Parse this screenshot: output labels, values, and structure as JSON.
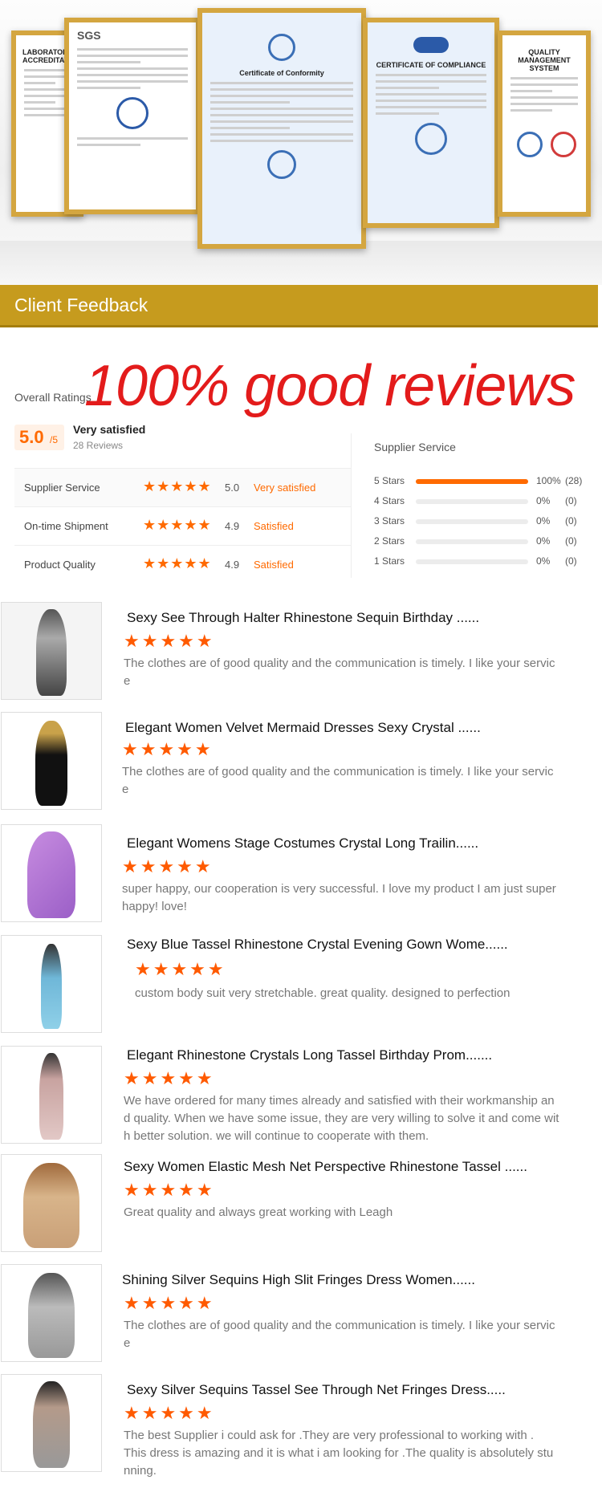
{
  "section_title": "Client Feedback",
  "headline": "100% good reviews",
  "overall": {
    "label": "Overall Ratings",
    "score": "5.0",
    "score_suffix": "/5",
    "summary": "Very satisfied",
    "review_count": "28 Reviews"
  },
  "metrics": [
    {
      "label": "Supplier Service",
      "stars": "★★★★★",
      "value": "5.0",
      "rating_text": "Very satisfied"
    },
    {
      "label": "On-time Shipment",
      "stars": "★★★★★",
      "value": "4.9",
      "rating_text": "Satisfied"
    },
    {
      "label": "Product Quality",
      "stars": "★★★★★",
      "value": "4.9",
      "rating_text": "Satisfied"
    }
  ],
  "distribution": {
    "title": "Supplier Service",
    "rows": [
      {
        "label": "5 Stars",
        "percent": "100%",
        "count": "(28)",
        "fraction": 1.0
      },
      {
        "label": "4 Stars",
        "percent": "0%",
        "count": "(0)",
        "fraction": 0
      },
      {
        "label": "3 Stars",
        "percent": "0%",
        "count": "(0)",
        "fraction": 0
      },
      {
        "label": "2 Stars",
        "percent": "0%",
        "count": "(0)",
        "fraction": 0
      },
      {
        "label": "1 Stars",
        "percent": "0%",
        "count": "(0)",
        "fraction": 0
      }
    ]
  },
  "reviews": [
    {
      "title": "Sexy See Through Halter Rhinestone Sequin Birthday ......",
      "stars": "★★★★★",
      "body": "The clothes are of good quality and the communication is timely. I like your servic\ne"
    },
    {
      "title": "Elegant Women Velvet Mermaid Dresses Sexy Crystal ......",
      "stars": "★★★★★",
      "body": "The clothes are of good quality and the communication is timely. I like your servic\ne"
    },
    {
      "title": "Elegant Womens Stage Costumes Crystal Long Trailin......",
      "stars": "★★★★★",
      "body": "super happy, our cooperation is very successful. I love my product I am just super\nhappy! love!"
    },
    {
      "title": "Sexy Blue Tassel Rhinestone Crystal Evening Gown Wome......",
      "stars": "★★★★★",
      "body": "custom body suit very stretchable. great quality. designed to perfection"
    },
    {
      "title": "Elegant Rhinestone Crystals Long Tassel Birthday Prom.......",
      "stars": "★★★★★",
      "body": "We have ordered for many times already and satisfied with their workmanship an\nd quality. When we have some issue, they are very willing to solve it and come wit\nh better solution. we will continue to cooperate with them."
    },
    {
      "title": "Sexy Women Elastic Mesh Net Perspective Rhinestone Tassel ......",
      "stars": "★★★★★",
      "body": "Great quality and always great working with Leagh"
    },
    {
      "title": "Shining Silver Sequins High Slit Fringes Dress Women......",
      "stars": "★★★★★",
      "body": "The clothes are of good quality and the communication is timely. I like your servic\ne"
    },
    {
      "title": "Sexy Silver Sequins Tassel See Through Net Fringes Dress.....",
      "stars": "★★★★★",
      "body": "The best Supplier i could ask for .They are very professional to working with .\nThis dress is amazing and it is what i am looking for .The quality is absolutely stu\nnning."
    }
  ],
  "certificates": [
    {
      "title": "LABORATORY ACCREDITATION"
    },
    {
      "title": "SGS"
    },
    {
      "title": "Certificate of Conformity"
    },
    {
      "title": "CERTIFICATE OF COMPLIANCE"
    },
    {
      "title": "QUALITY MANAGEMENT SYSTEM"
    }
  ],
  "colors": {
    "accent": "#ff6a00",
    "headline": "#e31b1b",
    "bar": "#c69b1e"
  }
}
